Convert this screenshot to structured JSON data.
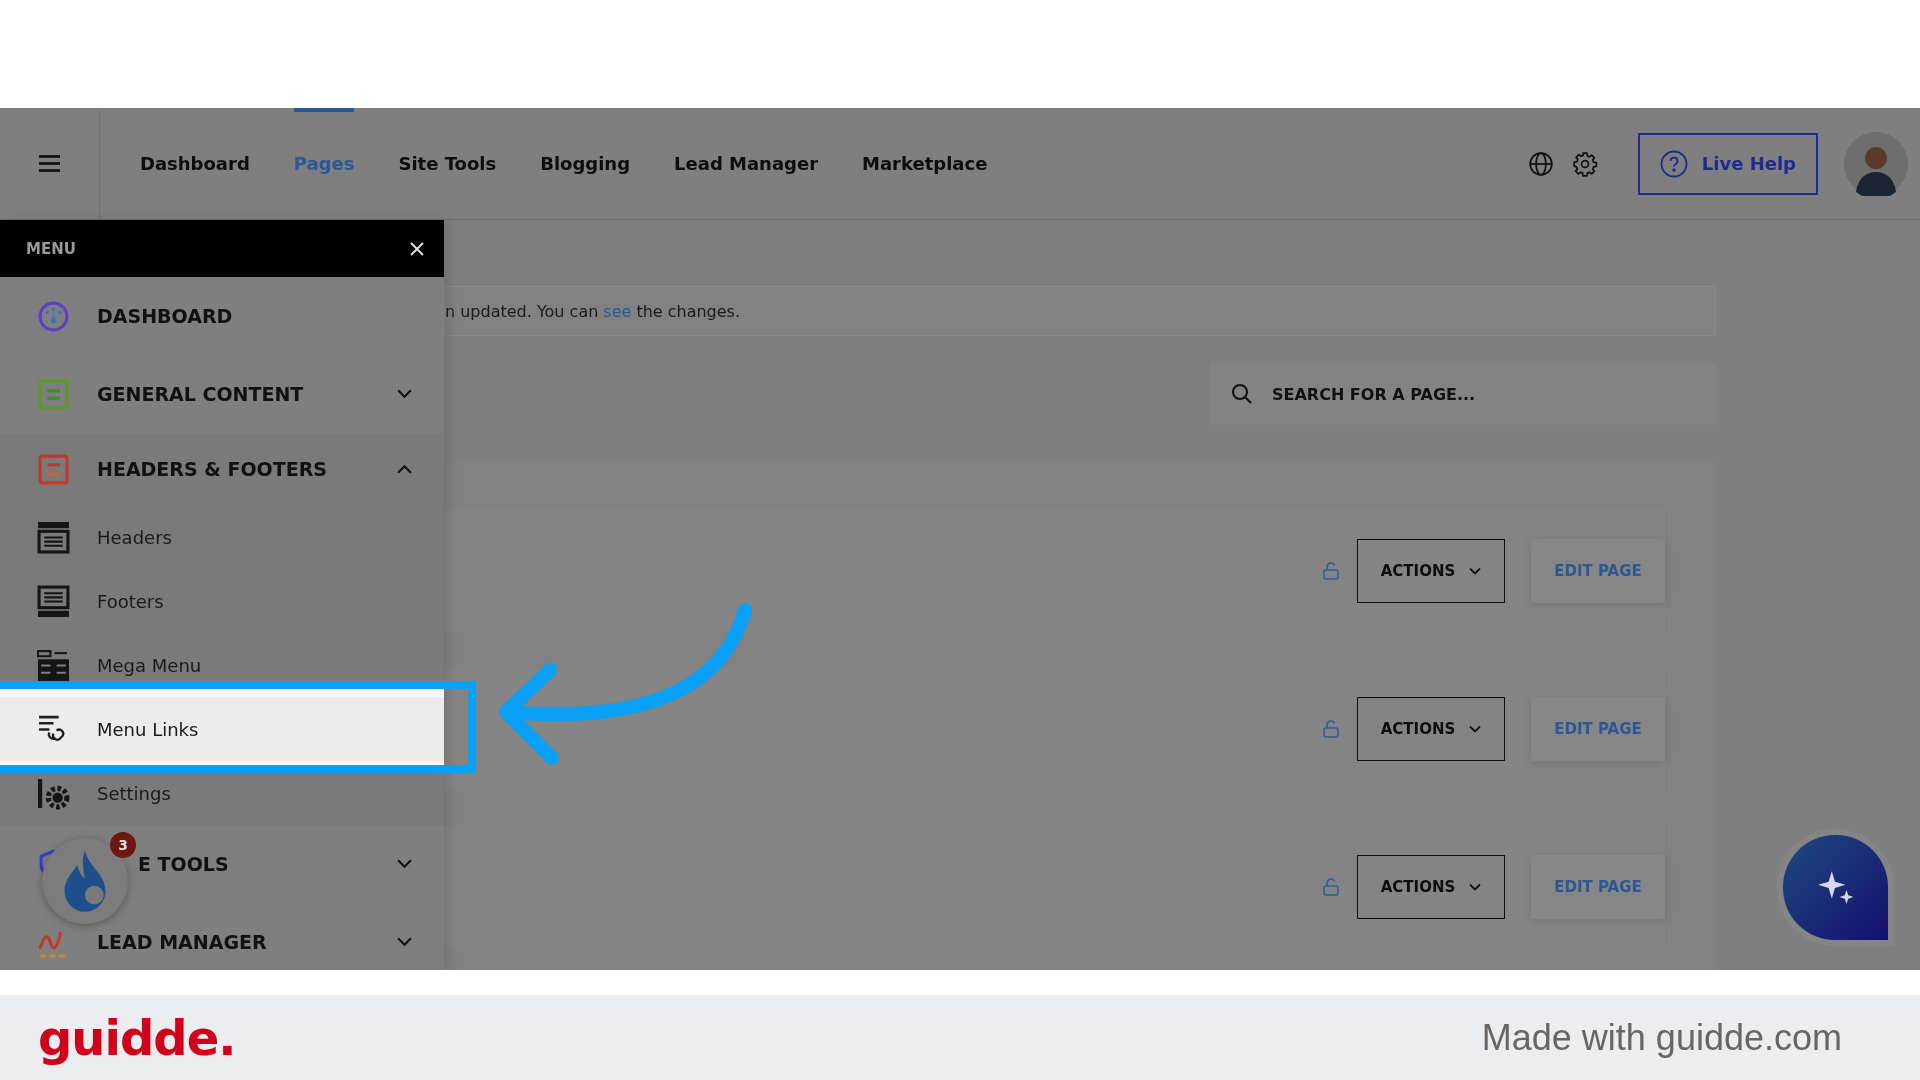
{
  "nav": {
    "items": [
      {
        "label": "Dashboard",
        "selected": false
      },
      {
        "label": "Pages",
        "selected": true
      },
      {
        "label": "Site Tools",
        "selected": false
      },
      {
        "label": "Blogging",
        "selected": false
      },
      {
        "label": "Lead Manager",
        "selected": false
      },
      {
        "label": "Marketplace",
        "selected": false
      }
    ],
    "help_button": "Live Help"
  },
  "menu": {
    "title": "MENU",
    "sections": [
      {
        "label": "DASHBOARD",
        "kind": "link"
      },
      {
        "label": "GENERAL CONTENT",
        "kind": "group",
        "expanded": false
      },
      {
        "label": "HEADERS & FOOTERS",
        "kind": "group",
        "expanded": true,
        "children": [
          {
            "label": "Headers",
            "selected": false
          },
          {
            "label": "Footers",
            "selected": false
          },
          {
            "label": "Mega Menu",
            "selected": false
          },
          {
            "label": "Menu Links",
            "selected": true
          },
          {
            "label": "Settings",
            "selected": false
          }
        ]
      },
      {
        "label": "E TOOLS",
        "kind": "group",
        "expanded": false
      },
      {
        "label": "LEAD MANAGER",
        "kind": "group",
        "expanded": false
      }
    ]
  },
  "widget_badge": "3",
  "notice": {
    "before": "n updated. You can",
    "link": "see",
    "after": "the changes."
  },
  "search": {
    "placeholder": "SEARCH FOR A PAGE..."
  },
  "pages": {
    "rows": [
      {
        "actions": "ACTIONS",
        "edit": "EDIT PAGE"
      },
      {
        "actions": "ACTIONS",
        "edit": "EDIT PAGE"
      },
      {
        "actions": "ACTIONS",
        "edit": "EDIT PAGE"
      }
    ]
  },
  "footer": {
    "logo": "guidde.",
    "credit": "Made with guidde.com"
  }
}
